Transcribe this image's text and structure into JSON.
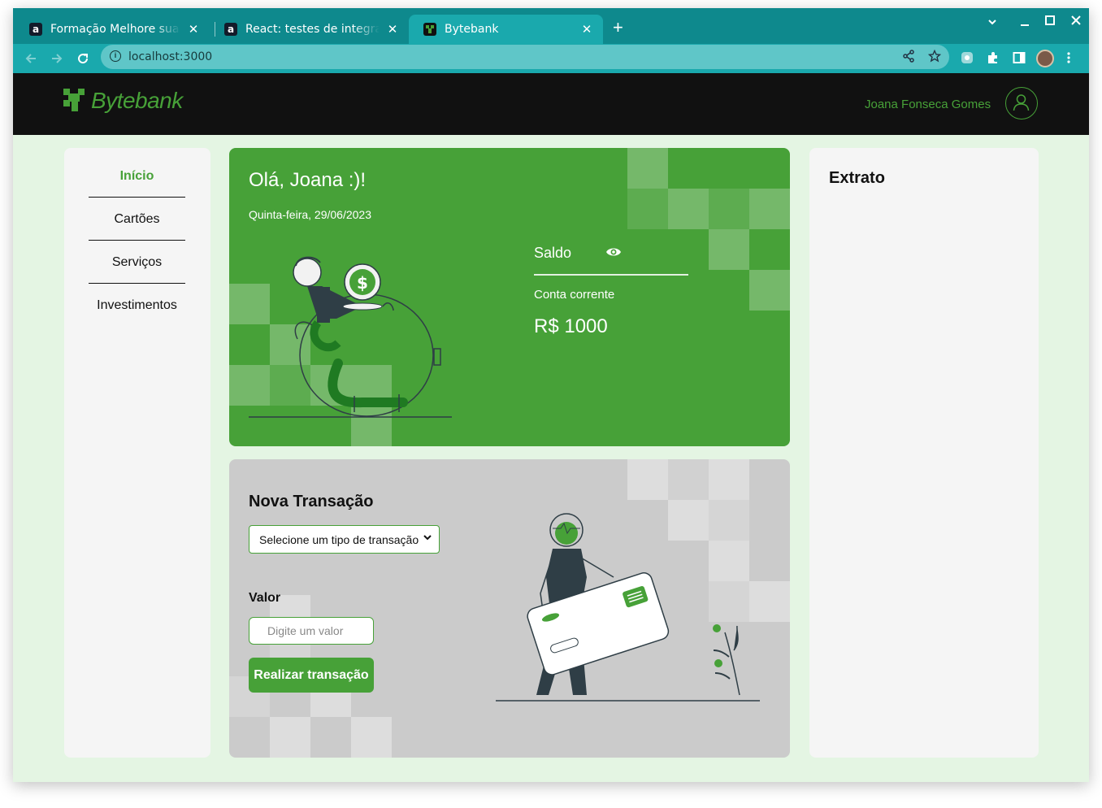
{
  "browser": {
    "tabs": [
      {
        "icon": "alura-icon",
        "title": "Formação Melhore sua ap",
        "close": "✕"
      },
      {
        "icon": "alura-icon",
        "title": "React: testes de integraçã",
        "close": "✕"
      },
      {
        "icon": "bytebank-icon",
        "title": "Bytebank",
        "close": "✕"
      }
    ],
    "new_tab": "+",
    "url": "localhost:3000"
  },
  "app": {
    "logo": "Bytebank",
    "username": "Joana Fonseca Gomes",
    "colors": {
      "primary": "#47a138",
      "header": "#111111",
      "page_bg": "#e4f5e3",
      "card_grey": "#cbcbcb"
    }
  },
  "sidebar": {
    "items": [
      {
        "label": "Início",
        "active": true
      },
      {
        "label": "Cartões",
        "active": false
      },
      {
        "label": "Serviços",
        "active": false
      },
      {
        "label": "Investimentos",
        "active": false
      }
    ]
  },
  "balance": {
    "greeting": "Olá, Joana :)!",
    "date": "Quinta-feira, 29/06/2023",
    "label": "Saldo",
    "account_type": "Conta corrente",
    "amount": "R$ 1000"
  },
  "transaction": {
    "title": "Nova Transação",
    "select_value": "Selecione um tipo de transação",
    "value_label": "Valor",
    "value_placeholder": "Digite um valor",
    "submit_label": "Realizar transação"
  },
  "statement": {
    "title": "Extrato"
  }
}
